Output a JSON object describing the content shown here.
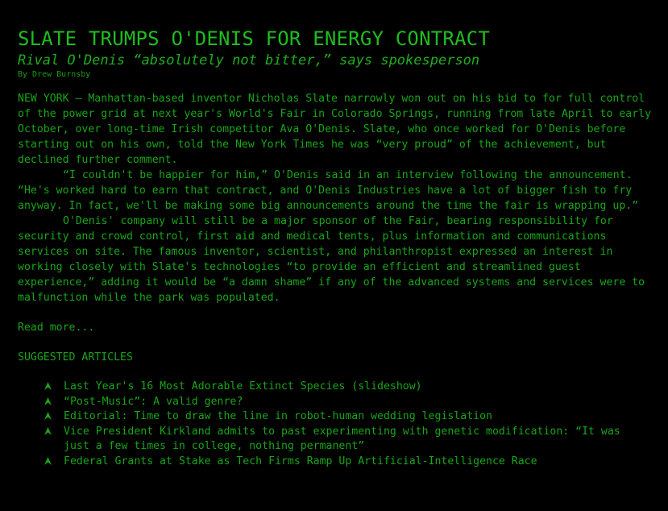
{
  "article": {
    "headline": "SLATE TRUMPS O'DENIS FOR ENERGY CONTRACT",
    "subheadline": "Rival O'Denis “absolutely not bitter,” says spokesperson",
    "byline": "By Drew Burnsby",
    "paragraphs": [
      "NEW YORK – Manhattan-based inventor Nicholas Slate narrowly won out on his bid to for full control of the power grid at next year's World's Fair in Colorado Springs, running from late April to early October, over long-time Irish competitor Ava O'Denis. Slate, who once worked for O'Denis before starting out on his own, told the New York Times he was “very proud” of the achievement, but declined further comment.",
      "“I couldn't be happier for him,” O'Denis said in an interview following the announcement. “He's worked hard to earn that contract, and O'Denis Industries have a lot of bigger fish to fry anyway. In fact, we'll be making some big announcements around the time the fair is wrapping up.”",
      "O'Denis' company will still be a major sponsor of the Fair, bearing responsibility for security and crowd control, first aid and medical tents, plus information and communications services on site. The famous inventor, scientist, and philanthropist expressed an interest in working closely with Slate's technologies “to provide an efficient and streamlined guest experience,” adding it would be “a damn shame” if any of the advanced systems and services were to malfunction while the park was populated."
    ],
    "read_more_label": "Read more..."
  },
  "suggested": {
    "heading": "SUGGESTED ARTICLES",
    "items": [
      "Last Year's 16 Most Adorable Extinct Species (slideshow)",
      "“Post-Music”: A valid genre?",
      "Editorial: Time to draw the line in robot-human wedding legislation",
      "Vice President Kirkland admits to past experimenting with genetic modification: “It was just a few times in college, nothing permanent”",
      "Federal Grants at Stake as Tech Firms Ramp Up Artificial-Intelligence Race"
    ],
    "bullet_icon": "arrow-up-bullet-icon"
  },
  "colors": {
    "background": "#000000",
    "headline": "#1fbd1f",
    "text": "#1aa51a"
  }
}
